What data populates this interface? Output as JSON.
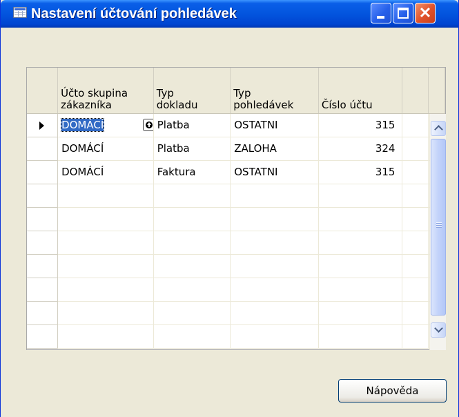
{
  "window": {
    "title": "Nastavení účtování pohledávek",
    "icon": "table-icon",
    "title_buttons": [
      "minimize-icon",
      "maximize-icon",
      "close-icon"
    ]
  },
  "grid": {
    "columns": [
      {
        "line1": "Účto skupina",
        "line2": "zákazníka"
      },
      {
        "line1": "Typ",
        "line2": "dokladu"
      },
      {
        "line1": "Typ",
        "line2": "pohledávek"
      },
      {
        "line1": "",
        "line2": "Číslo účtu"
      }
    ],
    "rows": [
      {
        "group": "DOMÁCÍ",
        "doc_type": "Platba",
        "receivable_type": "OSTATNI",
        "account": "315"
      },
      {
        "group": "DOMÁCÍ",
        "doc_type": "Platba",
        "receivable_type": "ZALOHA",
        "account": "324"
      },
      {
        "group": "DOMÁCÍ",
        "doc_type": "Faktura",
        "receivable_type": "OSTATNI",
        "account": "315"
      }
    ],
    "selected_row_index": 0,
    "empty_rows": 7
  },
  "buttons": {
    "help": "Nápověda"
  },
  "colors": {
    "titlebar": "#0355de",
    "selection": "#316ac5",
    "window_bg": "#ece9d8"
  }
}
